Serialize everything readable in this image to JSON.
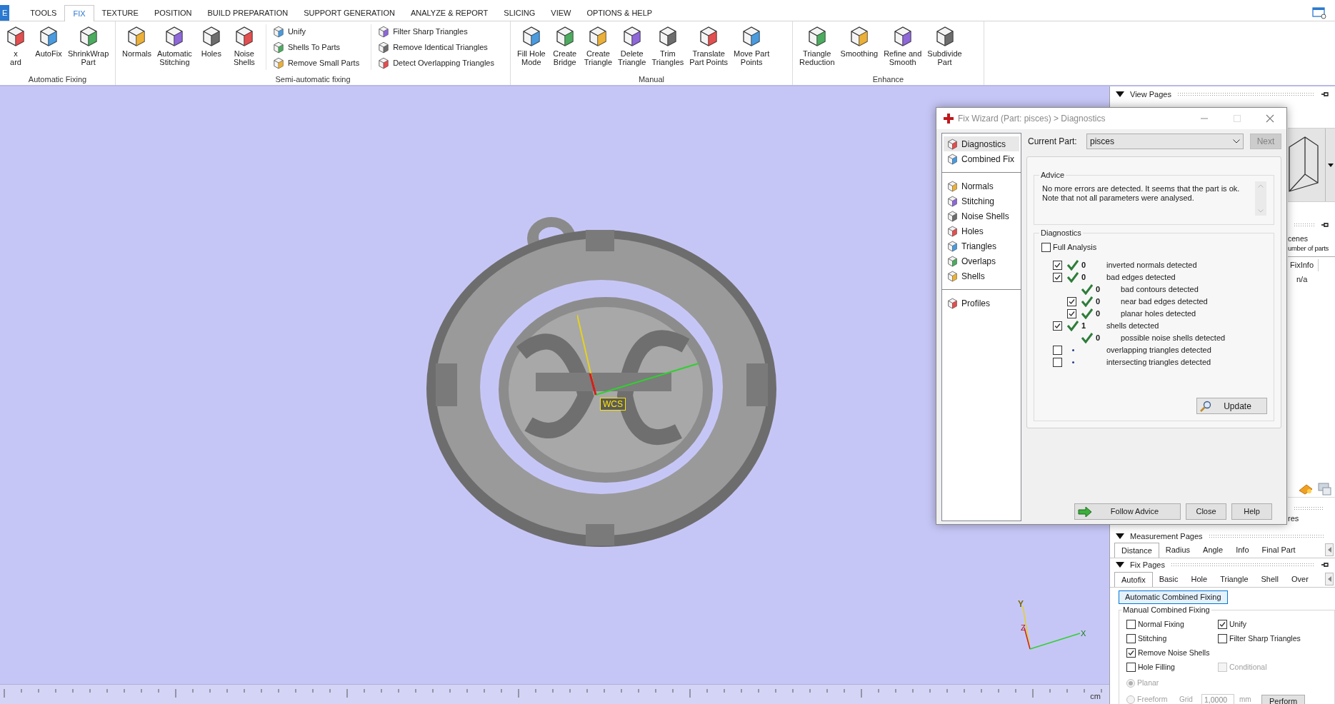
{
  "ribbon": {
    "tabs": [
      {
        "label": "E",
        "kind": "file",
        "selected": false
      },
      {
        "label": "TOOLS",
        "kind": "tab",
        "selected": false
      },
      {
        "label": "FIX",
        "kind": "tab",
        "selected": true
      },
      {
        "label": "TEXTURE",
        "kind": "tab",
        "selected": false
      },
      {
        "label": "POSITION",
        "kind": "tab",
        "selected": false
      },
      {
        "label": "BUILD PREPARATION",
        "kind": "tab",
        "selected": false
      },
      {
        "label": "SUPPORT GENERATION",
        "kind": "tab",
        "selected": false
      },
      {
        "label": "ANALYZE & REPORT",
        "kind": "tab",
        "selected": false
      },
      {
        "label": "SLICING",
        "kind": "tab",
        "selected": false
      },
      {
        "label": "VIEW",
        "kind": "tab",
        "selected": false
      },
      {
        "label": "OPTIONS & HELP",
        "kind": "tab",
        "selected": false
      }
    ],
    "groups": [
      {
        "label": "Automatic Fixing",
        "items": [
          {
            "kind": "large",
            "label": "x\nard"
          },
          {
            "kind": "large",
            "label": "AutoFix"
          },
          {
            "kind": "large",
            "label": "ShrinkWrap\nPart"
          }
        ]
      },
      {
        "label": "Semi-automatic fixing",
        "items": [
          {
            "kind": "large",
            "label": "Normals"
          },
          {
            "kind": "large",
            "label": "Automatic\nStitching"
          },
          {
            "kind": "large",
            "label": "Holes"
          },
          {
            "kind": "large",
            "label": "Noise\nShells"
          },
          {
            "kind": "list",
            "entries": [
              "Unify",
              "Shells To Parts",
              "Remove Small Parts"
            ]
          },
          {
            "kind": "list",
            "entries": [
              "Filter Sharp Triangles",
              "Remove Identical Triangles",
              "Detect Overlapping Triangles"
            ]
          }
        ]
      },
      {
        "label": "Manual",
        "items": [
          {
            "kind": "large",
            "label": "Fill Hole\nMode"
          },
          {
            "kind": "large",
            "label": "Create\nBridge"
          },
          {
            "kind": "large",
            "label": "Create\nTriangle"
          },
          {
            "kind": "large",
            "label": "Delete\nTriangle"
          },
          {
            "kind": "large",
            "label": "Trim\nTriangles"
          },
          {
            "kind": "large",
            "label": "Translate\nPart Points"
          },
          {
            "kind": "large",
            "label": "Move Part\nPoints"
          }
        ]
      },
      {
        "label": "Enhance",
        "items": [
          {
            "kind": "large",
            "label": "Triangle\nReduction"
          },
          {
            "kind": "large",
            "label": "Smoothing"
          },
          {
            "kind": "large",
            "label": "Refine and\nSmooth"
          },
          {
            "kind": "large",
            "label": "Subdivide\nPart"
          }
        ]
      }
    ]
  },
  "viewport": {
    "model": {
      "kind": "picture"
    },
    "wcs_label": "WCS",
    "axes": [
      "Y",
      "Z",
      "X"
    ],
    "ruler_unit": "cm"
  },
  "fix_wizard": {
    "title": "Fix Wizard (Part: pisces) > Diagnostics",
    "nav_sections": [
      [
        {
          "label": "Diagnostics",
          "selected": true
        },
        {
          "label": "Combined Fix",
          "selected": false
        }
      ],
      [
        {
          "label": "Normals",
          "selected": false
        },
        {
          "label": "Stitching",
          "selected": false
        },
        {
          "label": "Noise Shells",
          "selected": false
        },
        {
          "label": "Holes",
          "selected": false
        },
        {
          "label": "Triangles",
          "selected": false
        },
        {
          "label": "Overlaps",
          "selected": false
        },
        {
          "label": "Shells",
          "selected": false
        }
      ],
      [
        {
          "label": "Profiles",
          "selected": false
        }
      ]
    ],
    "current_part_label": "Current Part:",
    "current_part": "pisces",
    "next_button": {
      "label": "Next",
      "disabled": true
    },
    "advice": {
      "title": "Advice",
      "text": "No more errors are detected. It seems that the part is ok.\nNote that not all parameters were analysed."
    },
    "diagnostics": {
      "title": "Diagnostics",
      "full_analysis": {
        "label": "Full Analysis",
        "checked": false
      },
      "rows": [
        {
          "kind": "checkbox",
          "checked": true,
          "passed": true,
          "count": "0",
          "label": "inverted normals detected"
        },
        {
          "kind": "checkbox",
          "checked": true,
          "passed": true,
          "count": "0",
          "label": "bad edges detected",
          "children": [
            {
              "kind": "plain",
              "passed": true,
              "count": "0",
              "label": "bad contours detected"
            },
            {
              "kind": "checkbox",
              "checked": true,
              "passed": true,
              "count": "0",
              "label": "near bad edges detected"
            },
            {
              "kind": "checkbox",
              "checked": true,
              "passed": true,
              "count": "0",
              "label": "planar holes detected"
            }
          ]
        },
        {
          "kind": "checkbox",
          "checked": true,
          "passed": true,
          "count": "1",
          "label": "shells detected",
          "children": [
            {
              "kind": "plain",
              "passed": true,
              "count": "0",
              "label": "possible noise shells detected"
            }
          ]
        },
        {
          "kind": "checkbox",
          "checked": false,
          "passed": false,
          "label": "overlapping triangles detected"
        },
        {
          "kind": "checkbox",
          "checked": false,
          "passed": false,
          "label": "intersecting triangles detected"
        }
      ],
      "update_button": "Update"
    },
    "buttons": [
      "Follow Advice",
      "Close",
      "Help"
    ]
  },
  "right_panel": {
    "view_pages": {
      "title": "View Pages"
    },
    "scenes": {
      "texts": [
        "cenes",
        "umber of parts"
      ],
      "column": "FixInfo",
      "value": "n/a"
    },
    "cut_text": "res",
    "measurement_pages": {
      "title": "Measurement Pages",
      "tabs": [
        {
          "label": "Distance",
          "selected": true
        },
        {
          "label": "Radius",
          "selected": false
        },
        {
          "label": "Angle",
          "selected": false
        },
        {
          "label": "Info",
          "selected": false
        },
        {
          "label": "Final Part",
          "selected": false
        }
      ]
    },
    "fix_pages": {
      "title": "Fix Pages",
      "tabs": [
        {
          "label": "Autofix",
          "selected": true
        },
        {
          "label": "Basic",
          "selected": false
        },
        {
          "label": "Hole",
          "selected": false
        },
        {
          "label": "Triangle",
          "selected": false
        },
        {
          "label": "Shell",
          "selected": false
        },
        {
          "label": "Over",
          "selected": false
        }
      ],
      "auto_button": "Automatic Combined Fixing",
      "group_title": "Manual Combined Fixing",
      "option_rows": [
        [
          {
            "label": "Normal Fixing",
            "checked": false,
            "disabled": false
          },
          {
            "label": "Unify",
            "checked": true,
            "disabled": false
          }
        ],
        [
          {
            "label": "Stitching",
            "checked": false,
            "disabled": false
          },
          {
            "label": "Filter Sharp Triangles",
            "checked": false,
            "disabled": false
          }
        ],
        [
          {
            "label": "Remove Noise Shells",
            "checked": true,
            "disabled": false
          }
        ],
        [
          {
            "label": "Hole Filling",
            "checked": false,
            "disabled": false
          },
          {
            "label": "Conditional",
            "checked": false,
            "disabled": true
          }
        ]
      ],
      "radios": [
        {
          "label": "Planar",
          "selected": true,
          "disabled": true
        },
        {
          "label": "Freeform",
          "selected": false,
          "disabled": true
        }
      ],
      "grid_label": "Grid",
      "grid_value": "1,0000",
      "grid_unit": "mm",
      "perform_button": "Perform"
    }
  }
}
